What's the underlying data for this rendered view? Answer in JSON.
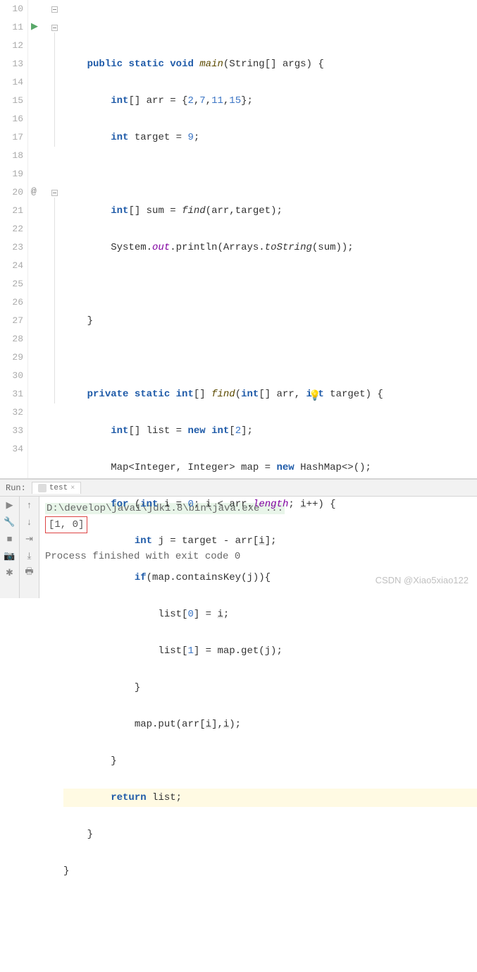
{
  "lines": {
    "10": "10",
    "11": "11",
    "12": "12",
    "13": "13",
    "14": "14",
    "15": "15",
    "16": "16",
    "17": "17",
    "18": "18",
    "19": "19",
    "20": "20",
    "21": "21",
    "22": "22",
    "23": "23",
    "24": "24",
    "25": "25",
    "26": "26",
    "27": "27",
    "28": "28",
    "29": "29",
    "30": "30",
    "31": "31",
    "32": "32",
    "33": "33",
    "34": "34"
  },
  "code": {
    "l11": {
      "t1": "public",
      "t2": "static",
      "t3": "void",
      "t4": "main",
      "t5": "(String[] args) {"
    },
    "l12": {
      "t1": "int",
      "t2": "[] arr = {",
      "n1": "2",
      "c1": ",",
      "n2": "7",
      "c2": ",",
      "n3": "11",
      "c3": ",",
      "n4": "15",
      "t3": "};"
    },
    "l13": {
      "t1": "int",
      "t2": " target = ",
      "n1": "9",
      "t3": ";"
    },
    "l15": {
      "t1": "int",
      "t2": "[] sum = ",
      "m1": "find",
      "t3": "(arr,target);"
    },
    "l16": {
      "t1": "System.",
      "f1": "out",
      "t2": ".println(Arrays.",
      "m1": "toString",
      "t3": "(sum));"
    },
    "l18": {
      "t1": "}"
    },
    "l20": {
      "t1": "private",
      "t2": "static",
      "t3": "int",
      "t4": "[] ",
      "m1": "find",
      "t5": "(",
      "t6": "int",
      "t7": "[] arr, ",
      "t8": "int",
      "t9": " target) {"
    },
    "l21": {
      "t1": "int",
      "t2": "[] list = ",
      "t3": "new",
      "t4": " ",
      "t5": "int",
      "t6": "[",
      "n1": "2",
      "t7": "];"
    },
    "l22": {
      "t1": "Map<Integer, Integer> map = ",
      "t2": "new",
      "t3": " HashMap<>();"
    },
    "l23": {
      "t1": "for",
      "t2": " (",
      "t3": "int",
      "t4": " ",
      "v1": "i",
      "t5": " = ",
      "n1": "0",
      "t6": "; ",
      "v2": "i",
      "t7": " < arr.",
      "f1": "length",
      "t8": "; ",
      "v3": "i",
      "t9": "++) {"
    },
    "l24": {
      "t1": "int",
      "t2": " j = target - arr[",
      "v1": "i",
      "t3": "];"
    },
    "l25": {
      "t1": "if",
      "t2": "(map.containsKey(j)){"
    },
    "l26": {
      "t1": "list[",
      "n1": "0",
      "t2": "] = ",
      "v1": "i",
      "t3": ";"
    },
    "l27": {
      "t1": "list[",
      "n1": "1",
      "t2": "] = map.get(j);"
    },
    "l28": {
      "t1": "}"
    },
    "l29": {
      "t1": "map.put(arr[",
      "v1": "i",
      "t2": "],",
      "v2": "i",
      "t3": ");"
    },
    "l30": {
      "t1": "}"
    },
    "l31": {
      "t1": "return",
      "t2": " list;"
    },
    "l32": {
      "t1": "}"
    },
    "l33": {
      "t1": "}"
    }
  },
  "run": {
    "label": "Run:",
    "tab": "test",
    "cmd": "D:\\develop\\java1\\jdk1.8\\bin\\java.exe ...",
    "output": "[1, 0]",
    "exit": "Process finished with exit code 0"
  },
  "watermark": "CSDN @Xiao5xiao122",
  "icons": {
    "play": "▶",
    "at": "@",
    "bulb": "💡",
    "up": "↑",
    "down": "↓",
    "wrench": "🔧",
    "stop": "■",
    "camera": "📷",
    "cog": "✱",
    "wrap": "⇥",
    "scroll": "⤓",
    "print": "🖶",
    "close": "×"
  }
}
